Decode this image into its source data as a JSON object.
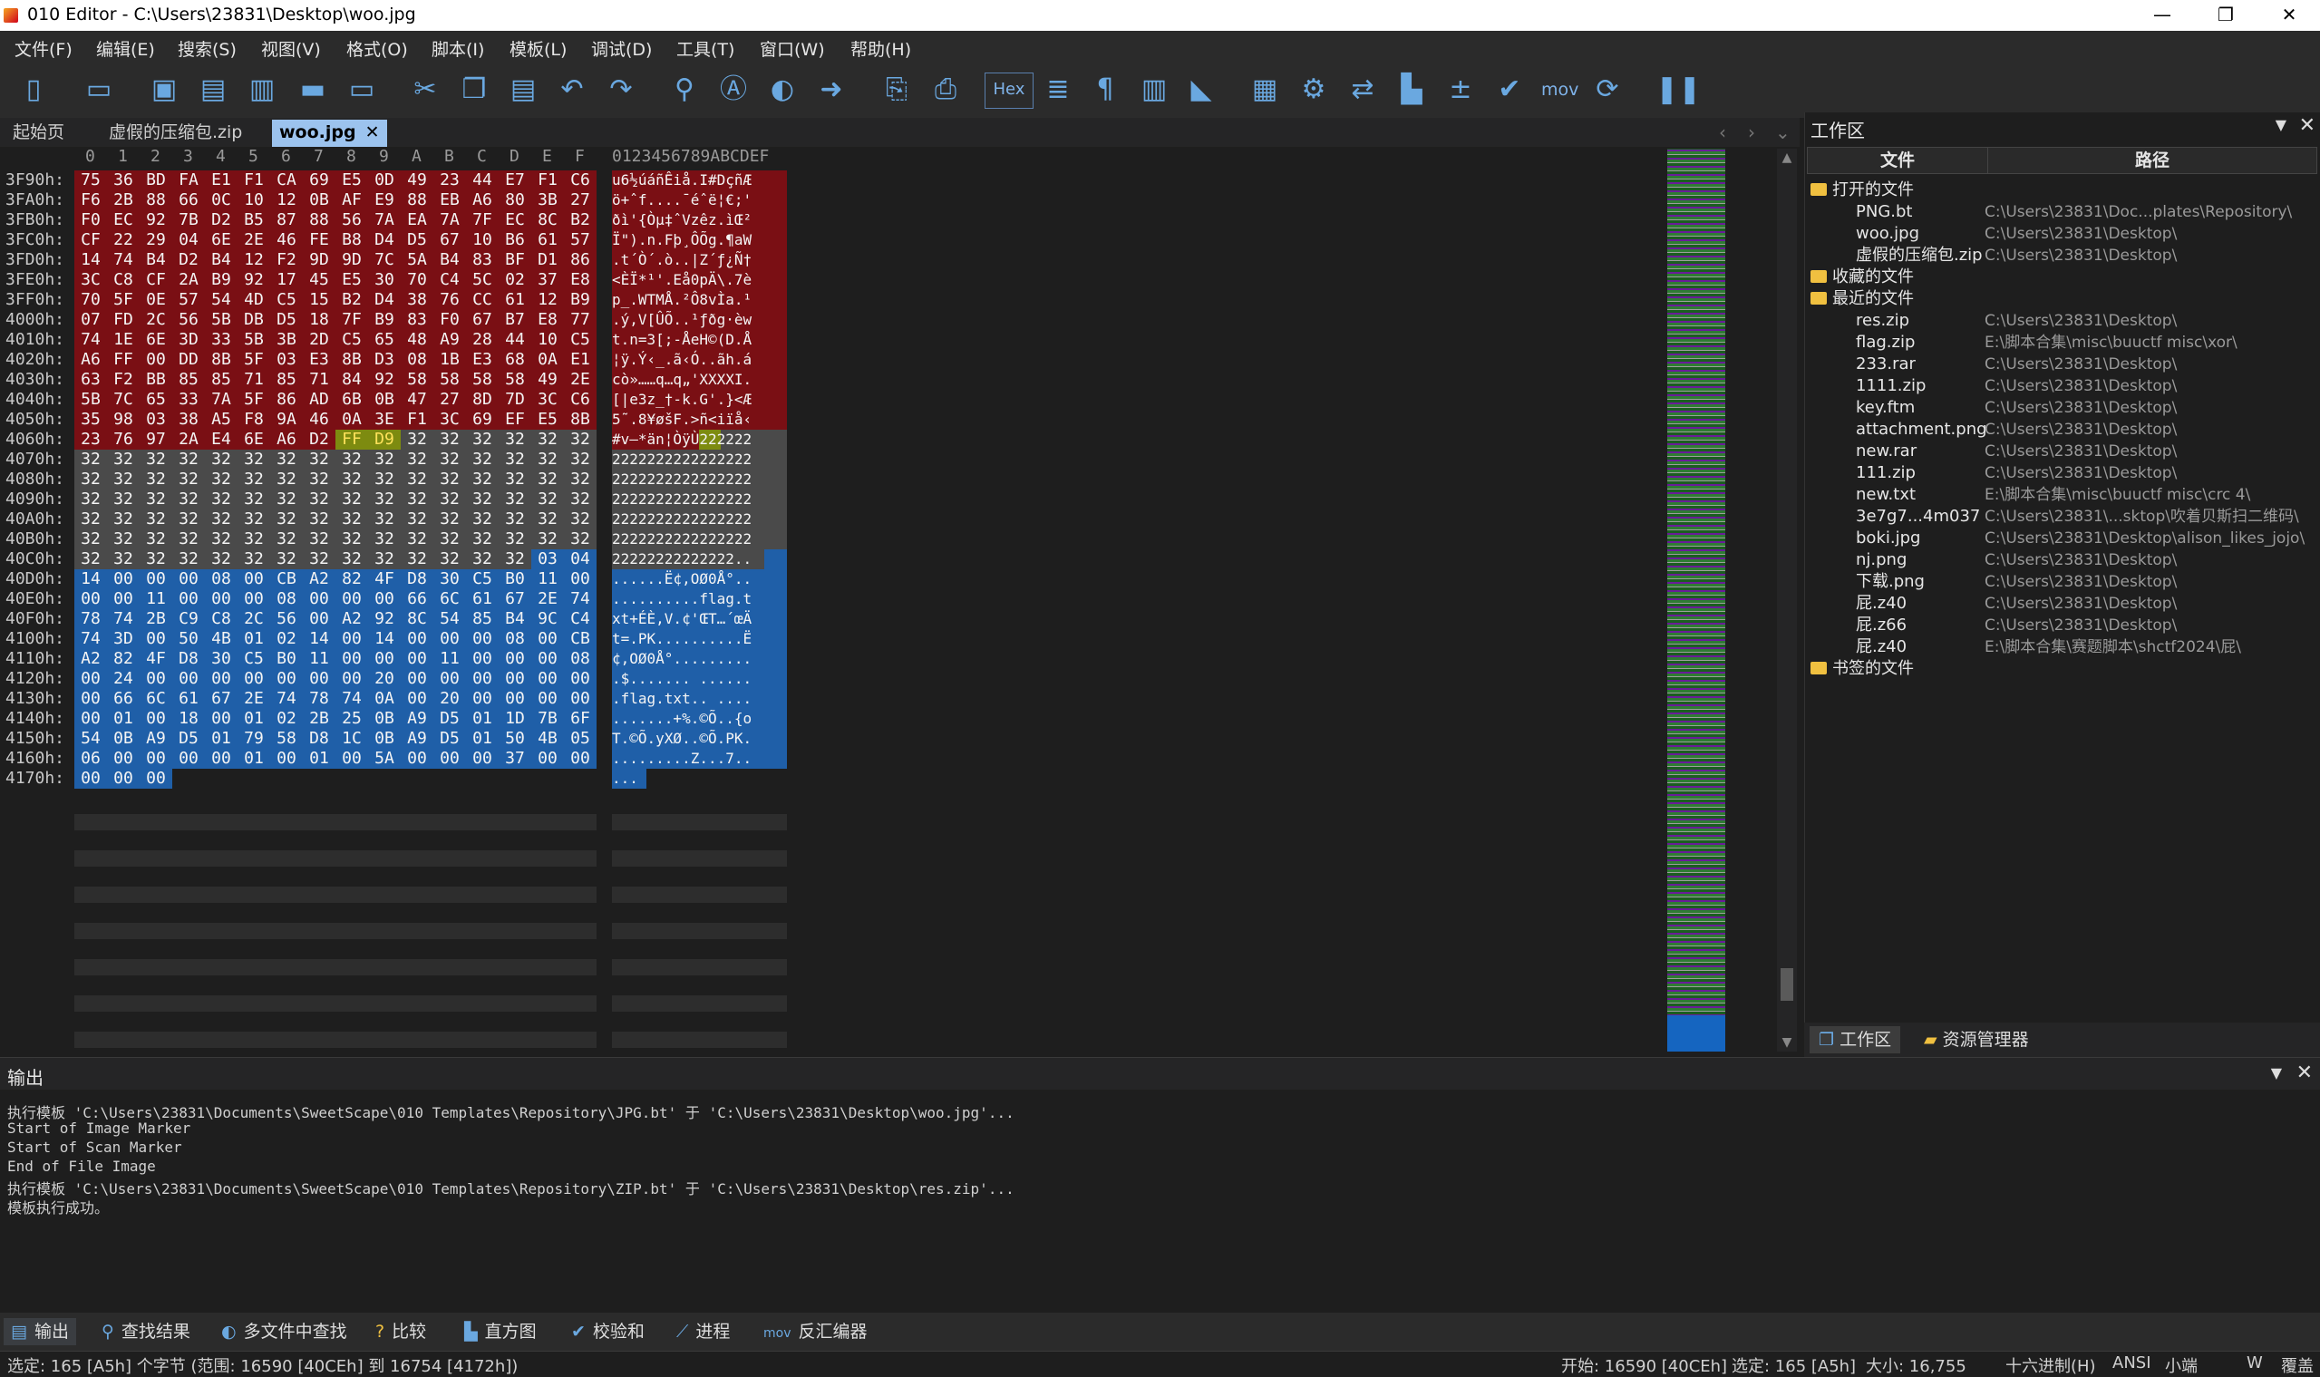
{
  "window": {
    "title": "010 Editor - C:\\Users\\23831\\Desktop\\woo.jpg",
    "minimize": "—",
    "maximize": "❐",
    "close": "✕"
  },
  "menu": [
    "文件(F)",
    "编辑(E)",
    "搜索(S)",
    "视图(V)",
    "格式(O)",
    "脚本(I)",
    "模板(L)",
    "调试(D)",
    "工具(T)",
    "窗口(W)",
    "帮助(H)"
  ],
  "toolbar": {
    "icons": [
      "new-file-icon",
      "open-file-icon",
      "save-icon",
      "save-as-icon",
      "save-all-icon",
      "open-folder-icon",
      "open-folder-2-icon",
      "cut-icon",
      "copy-icon",
      "paste-icon",
      "undo-icon",
      "redo-icon",
      "find-icon",
      "replace-icon",
      "find-in-files-icon",
      "goto-icon",
      "run-script-icon",
      "run-template-icon",
      "hex-mode",
      "column-icon",
      "pilcrow-icon",
      "columns-icon",
      "highlight-icon",
      "calculator-icon",
      "inspector-icon",
      "compare-icon",
      "histogram-icon",
      "calc-plus-icon",
      "checksum-icon",
      "mov",
      "base-convert-icon",
      "pause-icon"
    ],
    "hex_label": "Hex",
    "mov_label": "mov"
  },
  "doc_tabs": [
    {
      "label": "起始页",
      "active": false
    },
    {
      "label": "虚假的压缩包.zip",
      "active": false
    },
    {
      "label": "woo.jpg",
      "active": true
    }
  ],
  "hex_editor": {
    "column_header": [
      "0",
      "1",
      "2",
      "3",
      "4",
      "5",
      "6",
      "7",
      "8",
      "9",
      "A",
      "B",
      "C",
      "D",
      "E",
      "F"
    ],
    "ascii_header": "0123456789ABCDEF",
    "rows": [
      {
        "addr": "3F90h:",
        "bytes": [
          "75",
          "36",
          "BD",
          "FA",
          "E1",
          "F1",
          "CA",
          "69",
          "E5",
          "0D",
          "49",
          "23",
          "44",
          "E7",
          "F1",
          "C6"
        ],
        "ascii": "u6½úáñÊiå.I#DçñÆ"
      },
      {
        "addr": "3FA0h:",
        "bytes": [
          "F6",
          "2B",
          "88",
          "66",
          "0C",
          "10",
          "12",
          "0B",
          "AF",
          "E9",
          "88",
          "EB",
          "A6",
          "80",
          "3B",
          "27"
        ],
        "ascii": "ö+ˆf....¯éˆë¦€;'"
      },
      {
        "addr": "3FB0h:",
        "bytes": [
          "F0",
          "EC",
          "92",
          "7B",
          "D2",
          "B5",
          "87",
          "88",
          "56",
          "7A",
          "EA",
          "7A",
          "7F",
          "EC",
          "8C",
          "B2"
        ],
        "ascii": "ðì'{Òµ‡ˆVzêz.ìŒ²"
      },
      {
        "addr": "3FC0h:",
        "bytes": [
          "CF",
          "22",
          "29",
          "04",
          "6E",
          "2E",
          "46",
          "FE",
          "B8",
          "D4",
          "D5",
          "67",
          "10",
          "B6",
          "61",
          "57"
        ],
        "ascii": "Ï\").n.Fþ¸ÔÕg.¶aW"
      },
      {
        "addr": "3FD0h:",
        "bytes": [
          "14",
          "74",
          "B4",
          "D2",
          "B4",
          "12",
          "F2",
          "9D",
          "9D",
          "7C",
          "5A",
          "B4",
          "83",
          "BF",
          "D1",
          "86"
        ],
        "ascii": ".t´Ò´.ò..|Z´ƒ¿Ñ†"
      },
      {
        "addr": "3FE0h:",
        "bytes": [
          "3C",
          "C8",
          "CF",
          "2A",
          "B9",
          "92",
          "17",
          "45",
          "E5",
          "30",
          "70",
          "C4",
          "5C",
          "02",
          "37",
          "E8"
        ],
        "ascii": "<ÈÏ*¹'.Eå0pÄ\\.7è"
      },
      {
        "addr": "3FF0h:",
        "bytes": [
          "70",
          "5F",
          "0E",
          "57",
          "54",
          "4D",
          "C5",
          "15",
          "B2",
          "D4",
          "38",
          "76",
          "CC",
          "61",
          "12",
          "B9"
        ],
        "ascii": "p_.WTMÅ.²Ô8vÌa.¹"
      },
      {
        "addr": "4000h:",
        "bytes": [
          "07",
          "FD",
          "2C",
          "56",
          "5B",
          "DB",
          "D5",
          "18",
          "7F",
          "B9",
          "83",
          "F0",
          "67",
          "B7",
          "E8",
          "77"
        ],
        "ascii": ".ý,V[ÛÕ..¹ƒðg·èw"
      },
      {
        "addr": "4010h:",
        "bytes": [
          "74",
          "1E",
          "6E",
          "3D",
          "33",
          "5B",
          "3B",
          "2D",
          "C5",
          "65",
          "48",
          "A9",
          "28",
          "44",
          "10",
          "C5"
        ],
        "ascii": "t.n=3[;-ÅeH©(D.Å"
      },
      {
        "addr": "4020h:",
        "bytes": [
          "A6",
          "FF",
          "00",
          "DD",
          "8B",
          "5F",
          "03",
          "E3",
          "8B",
          "D3",
          "08",
          "1B",
          "E3",
          "68",
          "0A",
          "E1"
        ],
        "ascii": "¦ÿ.Ý‹_.ã‹Ó..ãh.á"
      },
      {
        "addr": "4030h:",
        "bytes": [
          "63",
          "F2",
          "BB",
          "85",
          "85",
          "71",
          "85",
          "71",
          "84",
          "92",
          "58",
          "58",
          "58",
          "58",
          "49",
          "2E"
        ],
        "ascii": "cò»……q…q„'XXXXI."
      },
      {
        "addr": "4040h:",
        "bytes": [
          "5B",
          "7C",
          "65",
          "33",
          "7A",
          "5F",
          "86",
          "AD",
          "6B",
          "0B",
          "47",
          "27",
          "8D",
          "7D",
          "3C",
          "C6"
        ],
        "ascii": "[|e3z_†-k.G'.}<Æ"
      },
      {
        "addr": "4050h:",
        "bytes": [
          "35",
          "98",
          "03",
          "38",
          "A5",
          "F8",
          "9A",
          "46",
          "0A",
          "3E",
          "F1",
          "3C",
          "69",
          "EF",
          "E5",
          "8B"
        ],
        "ascii": "5˜.8¥øšF.>ñ<iïå‹"
      },
      {
        "addr": "4060h:",
        "bytes": [
          "23",
          "76",
          "97",
          "2A",
          "E4",
          "6E",
          "A6",
          "D2",
          "FF",
          "D9",
          "32",
          "32",
          "32",
          "32",
          "32",
          "32"
        ],
        "ascii": "#v—*än¦ÒÿÙ222222"
      },
      {
        "addr": "4070h:",
        "bytes": [
          "32",
          "32",
          "32",
          "32",
          "32",
          "32",
          "32",
          "32",
          "32",
          "32",
          "32",
          "32",
          "32",
          "32",
          "32",
          "32"
        ],
        "ascii": "2222222222222222"
      },
      {
        "addr": "4080h:",
        "bytes": [
          "32",
          "32",
          "32",
          "32",
          "32",
          "32",
          "32",
          "32",
          "32",
          "32",
          "32",
          "32",
          "32",
          "32",
          "32",
          "32"
        ],
        "ascii": "2222222222222222"
      },
      {
        "addr": "4090h:",
        "bytes": [
          "32",
          "32",
          "32",
          "32",
          "32",
          "32",
          "32",
          "32",
          "32",
          "32",
          "32",
          "32",
          "32",
          "32",
          "32",
          "32"
        ],
        "ascii": "2222222222222222"
      },
      {
        "addr": "40A0h:",
        "bytes": [
          "32",
          "32",
          "32",
          "32",
          "32",
          "32",
          "32",
          "32",
          "32",
          "32",
          "32",
          "32",
          "32",
          "32",
          "32",
          "32"
        ],
        "ascii": "2222222222222222"
      },
      {
        "addr": "40B0h:",
        "bytes": [
          "32",
          "32",
          "32",
          "32",
          "32",
          "32",
          "32",
          "32",
          "32",
          "32",
          "32",
          "32",
          "32",
          "32",
          "32",
          "32"
        ],
        "ascii": "2222222222222222"
      },
      {
        "addr": "40C0h:",
        "bytes": [
          "32",
          "32",
          "32",
          "32",
          "32",
          "32",
          "32",
          "32",
          "32",
          "32",
          "32",
          "32",
          "32",
          "32",
          "03",
          "04"
        ],
        "ascii": "22222222222222.."
      },
      {
        "addr": "40D0h:",
        "bytes": [
          "14",
          "00",
          "00",
          "00",
          "08",
          "00",
          "CB",
          "A2",
          "82",
          "4F",
          "D8",
          "30",
          "C5",
          "B0",
          "11",
          "00"
        ],
        "ascii": "......Ë¢‚OØ0Å°.."
      },
      {
        "addr": "40E0h:",
        "bytes": [
          "00",
          "00",
          "11",
          "00",
          "00",
          "00",
          "08",
          "00",
          "00",
          "00",
          "66",
          "6C",
          "61",
          "67",
          "2E",
          "74"
        ],
        "ascii": "..........flag.t"
      },
      {
        "addr": "40F0h:",
        "bytes": [
          "78",
          "74",
          "2B",
          "C9",
          "C8",
          "2C",
          "56",
          "00",
          "A2",
          "92",
          "8C",
          "54",
          "85",
          "B4",
          "9C",
          "C4"
        ],
        "ascii": "xt+ÉÈ,V.¢'ŒT…´œÄ"
      },
      {
        "addr": "4100h:",
        "bytes": [
          "74",
          "3D",
          "00",
          "50",
          "4B",
          "01",
          "02",
          "14",
          "00",
          "14",
          "00",
          "00",
          "00",
          "08",
          "00",
          "CB"
        ],
        "ascii": "t=.PK..........Ë"
      },
      {
        "addr": "4110h:",
        "bytes": [
          "A2",
          "82",
          "4F",
          "D8",
          "30",
          "C5",
          "B0",
          "11",
          "00",
          "00",
          "00",
          "11",
          "00",
          "00",
          "00",
          "08"
        ],
        "ascii": "¢‚OØ0Å°........."
      },
      {
        "addr": "4120h:",
        "bytes": [
          "00",
          "24",
          "00",
          "00",
          "00",
          "00",
          "00",
          "00",
          "00",
          "20",
          "00",
          "00",
          "00",
          "00",
          "00",
          "00"
        ],
        "ascii": ".$....... ......"
      },
      {
        "addr": "4130h:",
        "bytes": [
          "00",
          "66",
          "6C",
          "61",
          "67",
          "2E",
          "74",
          "78",
          "74",
          "0A",
          "00",
          "20",
          "00",
          "00",
          "00",
          "00"
        ],
        "ascii": ".flag.txt.. ...."
      },
      {
        "addr": "4140h:",
        "bytes": [
          "00",
          "01",
          "00",
          "18",
          "00",
          "01",
          "02",
          "2B",
          "25",
          "0B",
          "A9",
          "D5",
          "01",
          "1D",
          "7B",
          "6F"
        ],
        "ascii": ".......+%.©Õ..{o"
      },
      {
        "addr": "4150h:",
        "bytes": [
          "54",
          "0B",
          "A9",
          "D5",
          "01",
          "79",
          "58",
          "D8",
          "1C",
          "0B",
          "A9",
          "D5",
          "01",
          "50",
          "4B",
          "05"
        ],
        "ascii": "T.©Õ.yXØ..©Õ.PK."
      },
      {
        "addr": "4160h:",
        "bytes": [
          "06",
          "00",
          "00",
          "00",
          "00",
          "01",
          "00",
          "01",
          "00",
          "5A",
          "00",
          "00",
          "00",
          "37",
          "00",
          "00"
        ],
        "ascii": ".........Z...7.."
      },
      {
        "addr": "4170h:",
        "bytes": [
          "00",
          "00",
          "00"
        ],
        "ascii": "..."
      }
    ]
  },
  "colors": {
    "jpg_data": "#7a0f14",
    "trailer_marker": "#7d8b10",
    "padding": "#4a4a4a",
    "zip_selected": "#1f5fa8"
  },
  "workspace": {
    "title": "工作区",
    "col_file": "文件",
    "col_path": "路径",
    "open_files_label": "打开的文件",
    "open_files": [
      {
        "name": "PNG.bt",
        "path": "C:\\Users\\23831\\Doc...plates\\Repository\\"
      },
      {
        "name": "woo.jpg",
        "path": "C:\\Users\\23831\\Desktop\\"
      },
      {
        "name": "虚假的压缩包.zip",
        "path": "C:\\Users\\23831\\Desktop\\"
      }
    ],
    "favorites_label": "收藏的文件",
    "recent_label": "最近的文件",
    "recent_files": [
      {
        "name": "res.zip",
        "path": "C:\\Users\\23831\\Desktop\\"
      },
      {
        "name": "flag.zip",
        "path": "E:\\脚本合集\\misc\\buuctf misc\\xor\\"
      },
      {
        "name": "233.rar",
        "path": "C:\\Users\\23831\\Desktop\\"
      },
      {
        "name": "1111.zip",
        "path": "C:\\Users\\23831\\Desktop\\"
      },
      {
        "name": "key.ftm",
        "path": "C:\\Users\\23831\\Desktop\\"
      },
      {
        "name": "attachment.png",
        "path": "C:\\Users\\23831\\Desktop\\"
      },
      {
        "name": "new.rar",
        "path": "C:\\Users\\23831\\Desktop\\"
      },
      {
        "name": "111.zip",
        "path": "C:\\Users\\23831\\Desktop\\"
      },
      {
        "name": "new.txt",
        "path": "E:\\脚本合集\\misc\\buuctf misc\\crc 4\\"
      },
      {
        "name": "3e7g7...4m037",
        "path": "C:\\Users\\23831\\...sktop\\吹着贝斯扫二维码\\"
      },
      {
        "name": "boki.jpg",
        "path": "C:\\Users\\23831\\Desktop\\alison_likes_jojo\\"
      },
      {
        "name": "nj.png",
        "path": "C:\\Users\\23831\\Desktop\\"
      },
      {
        "name": "下载.png",
        "path": "C:\\Users\\23831\\Desktop\\"
      },
      {
        "name": "屁.z40",
        "path": "C:\\Users\\23831\\Desktop\\"
      },
      {
        "name": "屁.z66",
        "path": "C:\\Users\\23831\\Desktop\\"
      },
      {
        "name": "屁.z40",
        "path": "E:\\脚本合集\\赛题脚本\\shctf2024\\屁\\"
      }
    ],
    "bookmarked_label": "书签的文件",
    "tab_workspace": "工作区",
    "tab_explorer": "资源管理器"
  },
  "output": {
    "title": "输出",
    "lines": [
      "执行模板 'C:\\Users\\23831\\Documents\\SweetScape\\010 Templates\\Repository\\JPG.bt' 于 'C:\\Users\\23831\\Desktop\\woo.jpg'...",
      "Start of Image Marker",
      "Start of Scan Marker",
      "End of File Image",
      "执行模板 'C:\\Users\\23831\\Documents\\SweetScape\\010 Templates\\Repository\\ZIP.bt' 于 'C:\\Users\\23831\\Desktop\\res.zip'...",
      "模板执行成功。"
    ]
  },
  "bottom_tabs": [
    "输出",
    "查找结果",
    "多文件中查找",
    "比较",
    "直方图",
    "校验和",
    "进程",
    "反汇编器"
  ],
  "status": {
    "selection": "选定: 165 [A5h] 个字节 (范围: 16590 [40CEh] 到 16754 [4172h])",
    "start": "开始: 16590 [40CEh]",
    "sel": "选定: 165 [A5h]",
    "size": "大小: 16,755",
    "mode": "十六进制(H)",
    "encoding": "ANSI",
    "endian": "小端",
    "w": "W",
    "overwrite": "覆盖"
  }
}
